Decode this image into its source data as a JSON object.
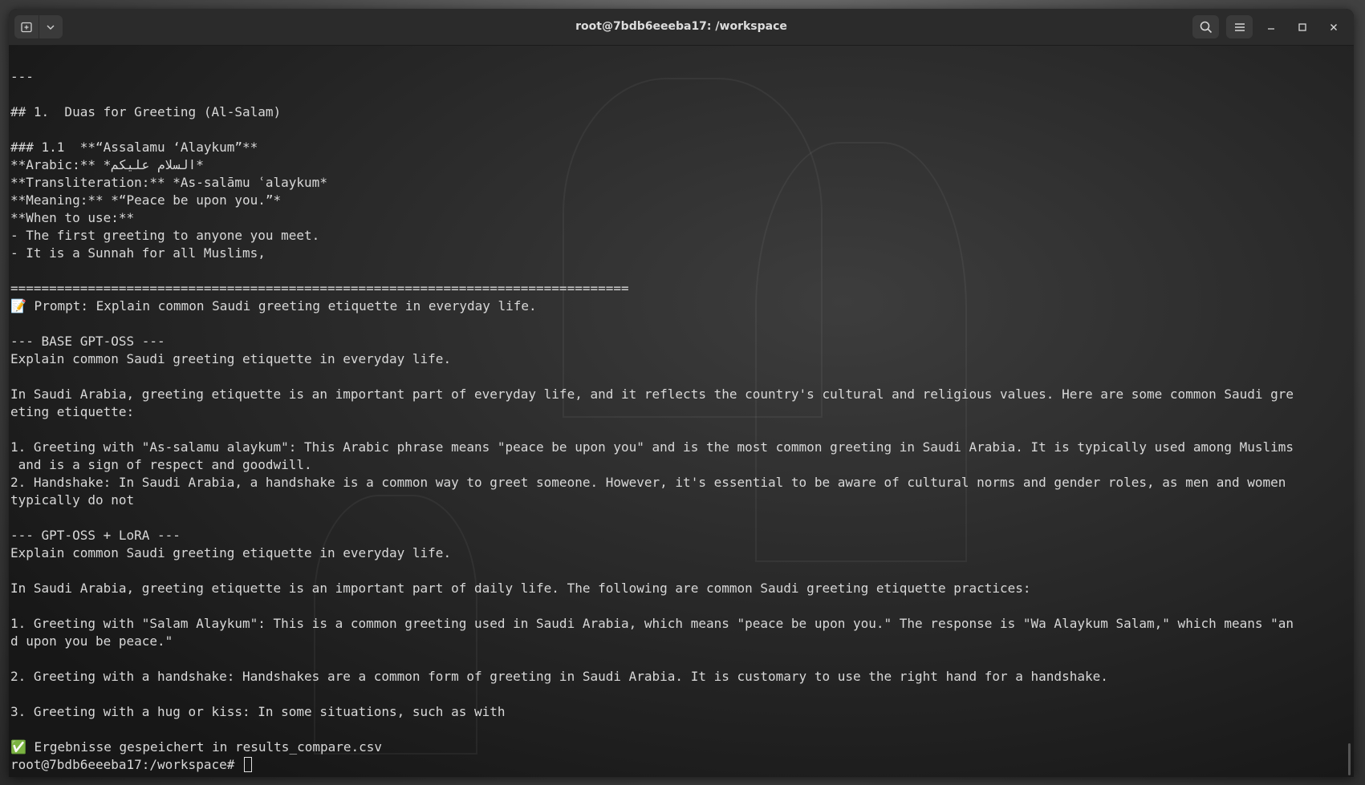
{
  "window": {
    "title": "root@7bdb6eeeba17: /workspace"
  },
  "titlebar": {
    "icons": {
      "new_tab": "new-tab-icon",
      "dropdown": "chevron-down-icon",
      "search": "search-icon",
      "menu": "hamburger-menu-icon",
      "minimize": "minimize-icon",
      "maximize": "maximize-icon",
      "close": "close-icon"
    }
  },
  "terminal": {
    "lines": [
      "---",
      "",
      "## 1.  Duas for Greeting (Al-Salam)",
      "",
      "### 1.1  **“Assalamu ‘Alaykum”**",
      "**Arabic:** *السلام عليكم*",
      "**Transliteration:** *As-salāmu ʿalaykum*",
      "**Meaning:** *“Peace be upon you.”*",
      "**When to use:**",
      "- The first greeting to anyone you meet.",
      "- It is a Sunnah for all Muslims,",
      "",
      "================================================================================",
      "📝 Prompt: Explain common Saudi greeting etiquette in everyday life.",
      "",
      "--- BASE GPT-OSS ---",
      "Explain common Saudi greeting etiquette in everyday life.",
      "",
      "In Saudi Arabia, greeting etiquette is an important part of everyday life, and it reflects the country's cultural and religious values. Here are some common Saudi gre",
      "eting etiquette:",
      "",
      "1. Greeting with \"As-salamu alaykum\": This Arabic phrase means \"peace be upon you\" and is the most common greeting in Saudi Arabia. It is typically used among Muslims",
      " and is a sign of respect and goodwill.",
      "2. Handshake: In Saudi Arabia, a handshake is a common way to greet someone. However, it's essential to be aware of cultural norms and gender roles, as men and women",
      "typically do not",
      "",
      "--- GPT-OSS + LoRA ---",
      "Explain common Saudi greeting etiquette in everyday life.",
      "",
      "In Saudi Arabia, greeting etiquette is an important part of daily life. The following are common Saudi greeting etiquette practices:",
      "",
      "1. Greeting with \"Salam Alaykum\": This is a common greeting used in Saudi Arabia, which means \"peace be upon you.\" The response is \"Wa Alaykum Salam,\" which means \"an",
      "d upon you be peace.\"",
      "",
      "2. Greeting with a handshake: Handshakes are a common form of greeting in Saudi Arabia. It is customary to use the right hand for a handshake.",
      "",
      "3. Greeting with a hug or kiss: In some situations, such as with",
      "",
      "✅ Ergebnisse gespeichert in results_compare.csv"
    ],
    "prompt": "root@7bdb6eeeba17:/workspace# "
  }
}
